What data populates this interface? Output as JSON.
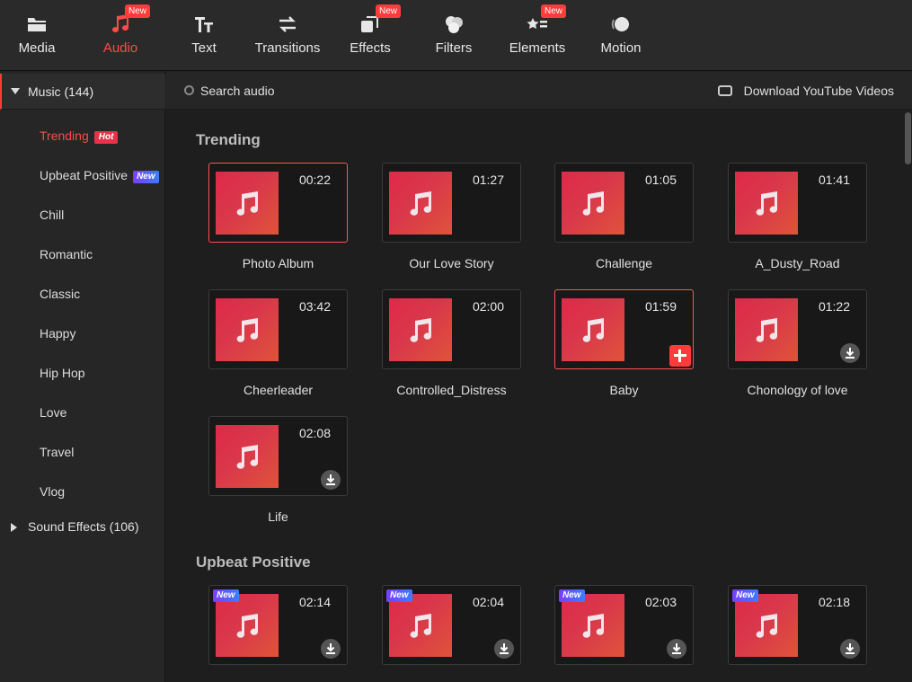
{
  "toolbar": {
    "items": [
      {
        "label": "Media",
        "icon": "folder-icon",
        "new": ""
      },
      {
        "label": "Audio",
        "icon": "music-note-icon",
        "new": "New"
      },
      {
        "label": "Text",
        "icon": "text-icon",
        "new": ""
      },
      {
        "label": "Transitions",
        "icon": "swap-arrows-icon",
        "new": ""
      },
      {
        "label": "Effects",
        "icon": "effects-icon",
        "new": "New"
      },
      {
        "label": "Filters",
        "icon": "filters-icon",
        "new": ""
      },
      {
        "label": "Elements",
        "icon": "elements-icon",
        "new": "New"
      },
      {
        "label": "Motion",
        "icon": "motion-icon",
        "new": ""
      }
    ],
    "active": "Audio",
    "accent": "#ff3b3b"
  },
  "sidebar": {
    "music": "Music (144)",
    "items": [
      {
        "label": "Trending",
        "tag": "Hot"
      },
      {
        "label": "Upbeat Positive",
        "tag": "New"
      },
      {
        "label": "Chill",
        "tag": ""
      },
      {
        "label": "Romantic",
        "tag": ""
      },
      {
        "label": "Classic",
        "tag": ""
      },
      {
        "label": "Happy",
        "tag": ""
      },
      {
        "label": "Hip Hop",
        "tag": ""
      },
      {
        "label": "Love",
        "tag": ""
      },
      {
        "label": "Travel",
        "tag": ""
      },
      {
        "label": "Vlog",
        "tag": ""
      }
    ],
    "sound_effects": "Sound Effects (106)"
  },
  "search": {
    "placeholder": "Search audio",
    "youtube": "Download YouTube Videos"
  },
  "sections": [
    {
      "title": "Trending",
      "cards": [
        {
          "name": "Photo Album",
          "duration": "00:22",
          "state": "selected"
        },
        {
          "name": "Our Love Story",
          "duration": "01:27",
          "state": ""
        },
        {
          "name": "Challenge",
          "duration": "01:05",
          "state": ""
        },
        {
          "name": "A_Dusty_Road",
          "duration": "01:41",
          "state": ""
        },
        {
          "name": "Cheerleader",
          "duration": "03:42",
          "state": ""
        },
        {
          "name": "Controlled_Distress",
          "duration": "02:00",
          "state": ""
        },
        {
          "name": "Baby",
          "duration": "01:59",
          "state": "hover-add"
        },
        {
          "name": "Chonology of love",
          "duration": "01:22",
          "state": "download"
        },
        {
          "name": "Life",
          "duration": "02:08",
          "state": "download"
        }
      ]
    },
    {
      "title": "Upbeat Positive",
      "cards": [
        {
          "name": "",
          "duration": "02:14",
          "state": "download",
          "new": "New"
        },
        {
          "name": "",
          "duration": "02:04",
          "state": "download",
          "new": "New"
        },
        {
          "name": "",
          "duration": "02:03",
          "state": "download",
          "new": "New"
        },
        {
          "name": "",
          "duration": "02:18",
          "state": "download",
          "new": "New"
        }
      ]
    }
  ]
}
